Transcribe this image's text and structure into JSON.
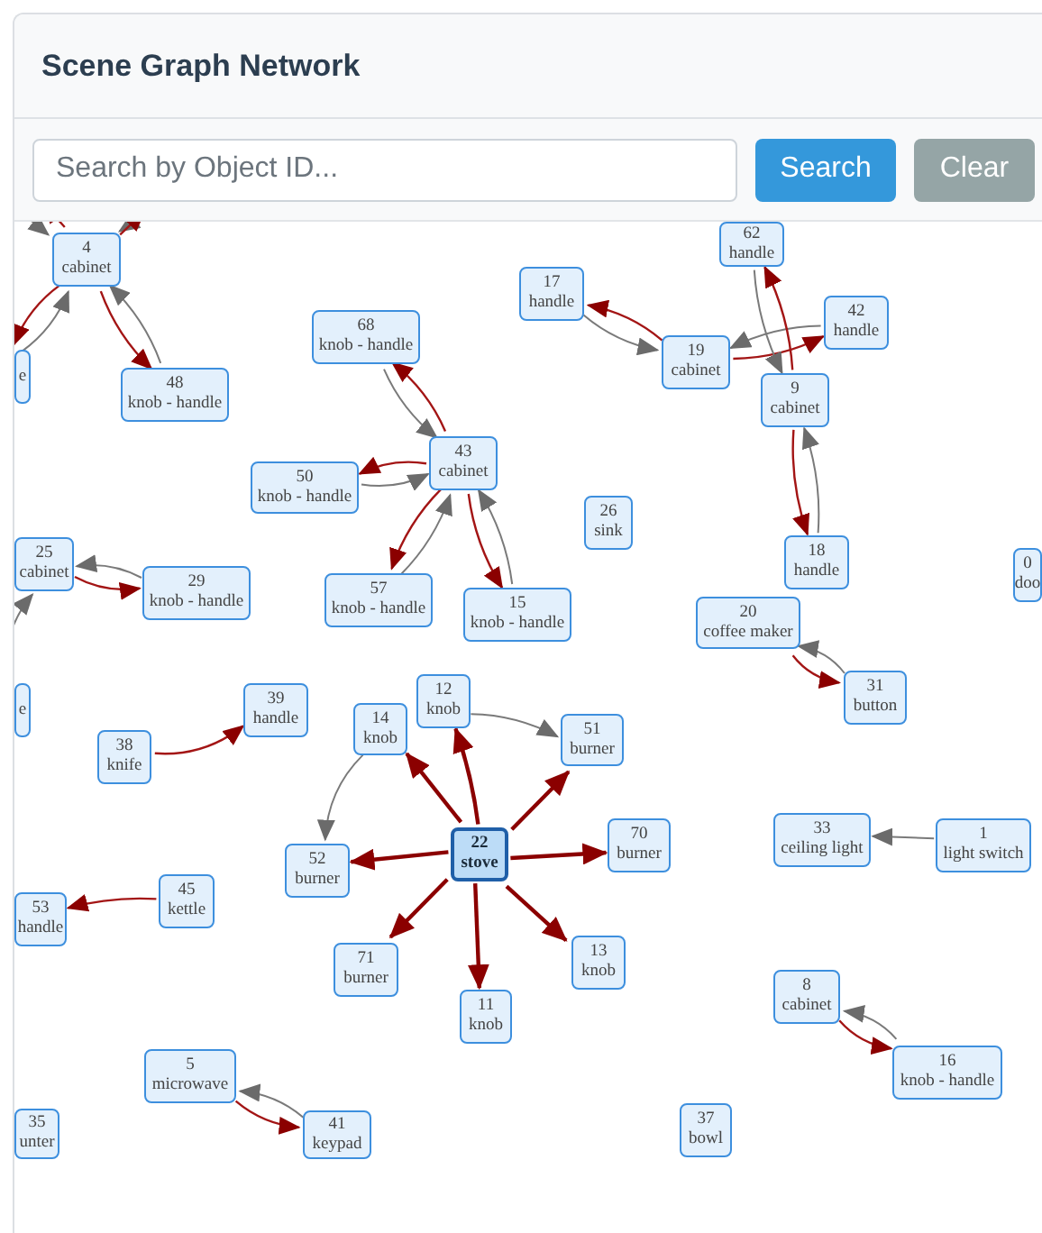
{
  "header": {
    "title": "Scene Graph Network"
  },
  "search": {
    "placeholder": "Search by Object ID..."
  },
  "buttons": [
    {
      "label": "Search",
      "kind": "primary"
    },
    {
      "label": "Clear",
      "kind": "secondary"
    }
  ],
  "graph": {
    "nodes": [
      {
        "lines": [
          "4",
          "cabinet"
        ],
        "selected": false
      },
      {
        "lines": [
          "e"
        ],
        "selected": false
      },
      {
        "lines": [
          "48",
          "knob - handle"
        ],
        "selected": false
      },
      {
        "lines": [
          "68",
          "knob - handle"
        ],
        "selected": false
      },
      {
        "lines": [
          "43",
          "cabinet"
        ],
        "selected": false
      },
      {
        "lines": [
          "50",
          "knob - handle"
        ],
        "selected": false
      },
      {
        "lines": [
          "57",
          "knob - handle"
        ],
        "selected": false
      },
      {
        "lines": [
          "15",
          "knob - handle"
        ],
        "selected": false
      },
      {
        "lines": [
          "25",
          "cabinet"
        ],
        "selected": false
      },
      {
        "lines": [
          "29",
          "knob - handle"
        ],
        "selected": false
      },
      {
        "lines": [
          "62",
          "handle"
        ],
        "selected": false
      },
      {
        "lines": [
          "17",
          "handle"
        ],
        "selected": false
      },
      {
        "lines": [
          "19",
          "cabinet"
        ],
        "selected": false
      },
      {
        "lines": [
          "42",
          "handle"
        ],
        "selected": false
      },
      {
        "lines": [
          "9",
          "cabinet"
        ],
        "selected": false
      },
      {
        "lines": [
          "26",
          "sink"
        ],
        "selected": false
      },
      {
        "lines": [
          "18",
          "handle"
        ],
        "selected": false
      },
      {
        "lines": [
          "0",
          "doo"
        ],
        "selected": false
      },
      {
        "lines": [
          "20",
          "coffee maker"
        ],
        "selected": false
      },
      {
        "lines": [
          "31",
          "button"
        ],
        "selected": false
      },
      {
        "lines": [
          "e"
        ],
        "selected": false
      },
      {
        "lines": [
          "39",
          "handle"
        ],
        "selected": false
      },
      {
        "lines": [
          "38",
          "knife"
        ],
        "selected": false
      },
      {
        "lines": [
          "14",
          "knob"
        ],
        "selected": false
      },
      {
        "lines": [
          "12",
          "knob"
        ],
        "selected": false
      },
      {
        "lines": [
          "51",
          "burner"
        ],
        "selected": false
      },
      {
        "lines": [
          "22",
          "stove"
        ],
        "selected": true
      },
      {
        "lines": [
          "52",
          "burner"
        ],
        "selected": false
      },
      {
        "lines": [
          "70",
          "burner"
        ],
        "selected": false
      },
      {
        "lines": [
          "33",
          "ceiling light"
        ],
        "selected": false
      },
      {
        "lines": [
          "1",
          "light switch"
        ],
        "selected": false
      },
      {
        "lines": [
          "53",
          "handle"
        ],
        "selected": false
      },
      {
        "lines": [
          "45",
          "kettle"
        ],
        "selected": false
      },
      {
        "lines": [
          "71",
          "burner"
        ],
        "selected": false
      },
      {
        "lines": [
          "13",
          "knob"
        ],
        "selected": false
      },
      {
        "lines": [
          "11",
          "knob"
        ],
        "selected": false
      },
      {
        "lines": [
          "8",
          "cabinet"
        ],
        "selected": false
      },
      {
        "lines": [
          "5",
          "microwave"
        ],
        "selected": false
      },
      {
        "lines": [
          "16",
          "knob - handle"
        ],
        "selected": false
      },
      {
        "lines": [
          "35",
          "unter"
        ],
        "selected": false
      },
      {
        "lines": [
          "41",
          "keypad"
        ],
        "selected": false
      },
      {
        "lines": [
          "37",
          "bowl"
        ],
        "selected": false
      }
    ]
  }
}
